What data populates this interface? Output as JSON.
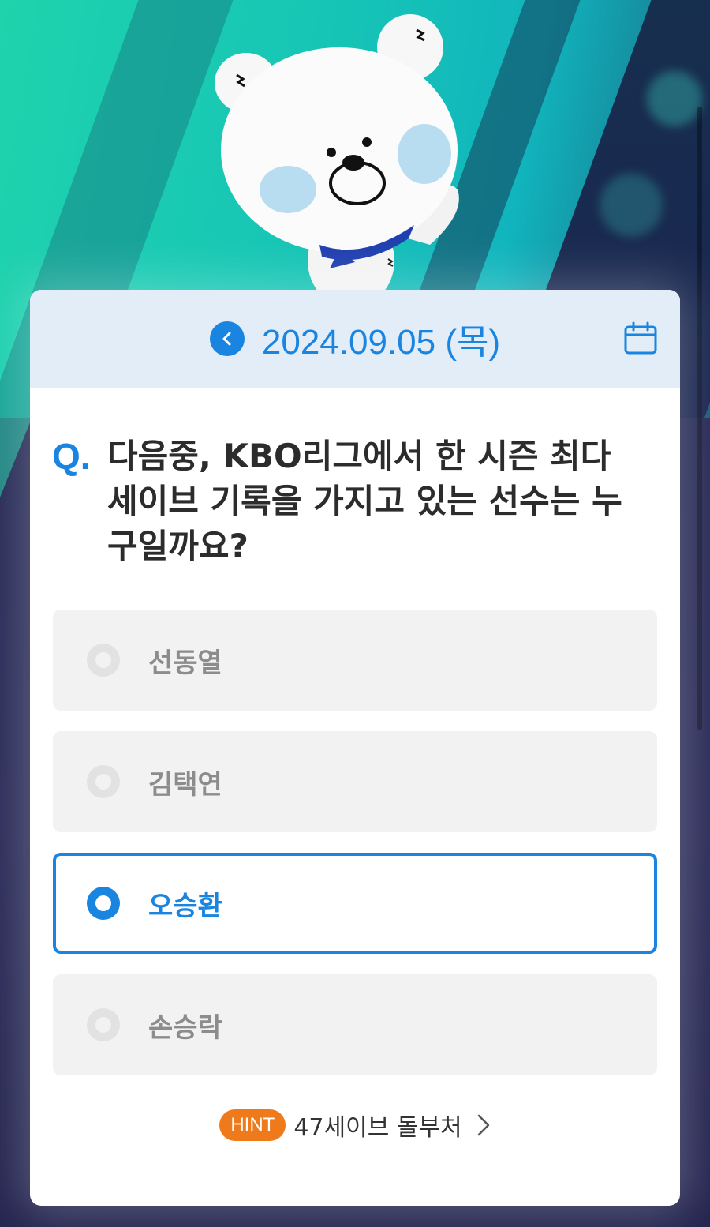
{
  "header": {
    "date": "2024.09.05 (목)",
    "back_icon": "chevron-left-icon",
    "calendar_icon": "calendar-icon"
  },
  "question": {
    "marker": "Q.",
    "text": "다음중, KBO리그에서 한 시즌 최다 세이브 기록을 가지고 있는 선수는 누구일까요?"
  },
  "options": [
    {
      "label": "선동열",
      "selected": false
    },
    {
      "label": "김택연",
      "selected": false
    },
    {
      "label": "오승환",
      "selected": true
    },
    {
      "label": "손승락",
      "selected": false
    }
  ],
  "hint": {
    "badge": "HINT",
    "text": "47세이브 돌부처"
  },
  "colors": {
    "accent": "#1a85e0",
    "hint_badge": "#ee7a1c",
    "header_bg": "#e3edf8"
  }
}
